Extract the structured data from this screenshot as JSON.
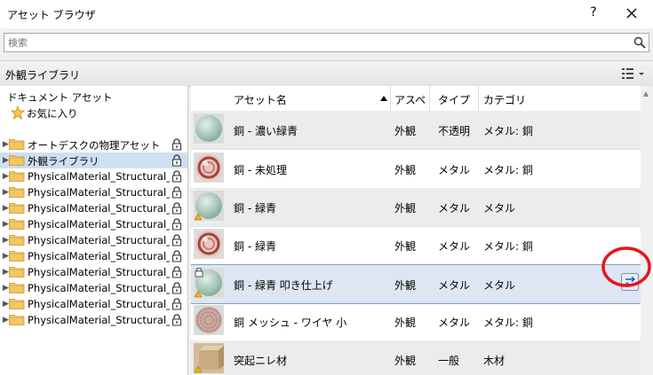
{
  "window": {
    "title": "アセット ブラウザ",
    "help_label": "?"
  },
  "search": {
    "placeholder": "検索"
  },
  "library_header": {
    "title": "外観ライブラリ"
  },
  "tree": {
    "root_label": "ドキュメント アセット",
    "favorites_label": "お気に入り",
    "items": [
      {
        "label": "オートデスクの物理アセット",
        "locked": true
      },
      {
        "label": "外観ライブラリ",
        "locked": true,
        "selected": true
      },
      {
        "label": "PhysicalMaterial_Structural_...",
        "locked": true
      },
      {
        "label": "PhysicalMaterial_Structural_...",
        "locked": true
      },
      {
        "label": "PhysicalMaterial_Structural_...",
        "locked": true
      },
      {
        "label": "PhysicalMaterial_Structural_...",
        "locked": true
      },
      {
        "label": "PhysicalMaterial_Structural_...",
        "locked": true
      },
      {
        "label": "PhysicalMaterial_Structural_...",
        "locked": true
      },
      {
        "label": "PhysicalMaterial_Structural_...",
        "locked": true
      },
      {
        "label": "PhysicalMaterial_Structural_...",
        "locked": true
      },
      {
        "label": "PhysicalMaterial_Structural_...",
        "locked": true
      },
      {
        "label": "PhysicalMaterial_Structural_...",
        "locked": true
      }
    ]
  },
  "grid": {
    "columns": [
      "アセット名",
      "アスペクト",
      "タイプ",
      "カテゴリ"
    ],
    "rows": [
      {
        "name": "銅 - 濃い緑青",
        "aspect": "外観",
        "type": "不透明",
        "category": "メタル: 銅",
        "thumb": "green"
      },
      {
        "name": "銅 - 未処理",
        "aspect": "外観",
        "type": "メタル",
        "category": "メタル: 銅",
        "thumb": "copper"
      },
      {
        "name": "銅 - 緑青",
        "aspect": "外観",
        "type": "メタル",
        "category": "メタル",
        "thumb": "green",
        "warn": true
      },
      {
        "name": "銅 - 緑青",
        "aspect": "外観",
        "type": "メタル",
        "category": "メタル: 銅",
        "thumb": "copper2"
      },
      {
        "name": "銅 - 緑青 叩き仕上げ",
        "aspect": "外観",
        "type": "メタル",
        "category": "メタル",
        "thumb": "green",
        "warn": true,
        "locked": true,
        "selected": true
      },
      {
        "name": "銅 メッシュ - ワイヤ 小",
        "aspect": "外観",
        "type": "メタル",
        "category": "メタル: 銅",
        "thumb": "mesh"
      },
      {
        "name": "突起ニレ材",
        "aspect": "外観",
        "type": "一般",
        "category": "木材",
        "thumb": "wood",
        "warn": true
      }
    ]
  },
  "colors": {
    "selection": "#cfdff2",
    "accent": "#1c5fb0",
    "highlight_ring": "#e8141c"
  }
}
